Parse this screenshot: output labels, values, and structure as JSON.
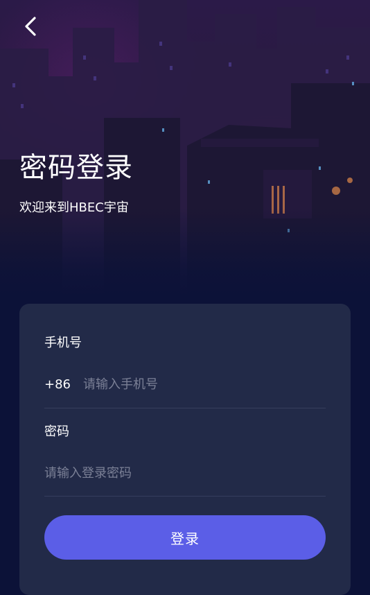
{
  "header": {
    "back_icon": "chevron-left-icon",
    "title": "密码登录",
    "subtitle": "欢迎来到HBEC宇宙"
  },
  "form": {
    "phone": {
      "label": "手机号",
      "country_code": "+86",
      "placeholder": "请输入手机号",
      "value": ""
    },
    "password": {
      "label": "密码",
      "placeholder": "请输入登录密码",
      "value": ""
    },
    "submit_label": "登录"
  },
  "colors": {
    "background": "#0c1238",
    "card": "#222a48",
    "primary_button": "#5b5ee7",
    "placeholder_text": "#7b8096",
    "divider": "#363e5d"
  }
}
